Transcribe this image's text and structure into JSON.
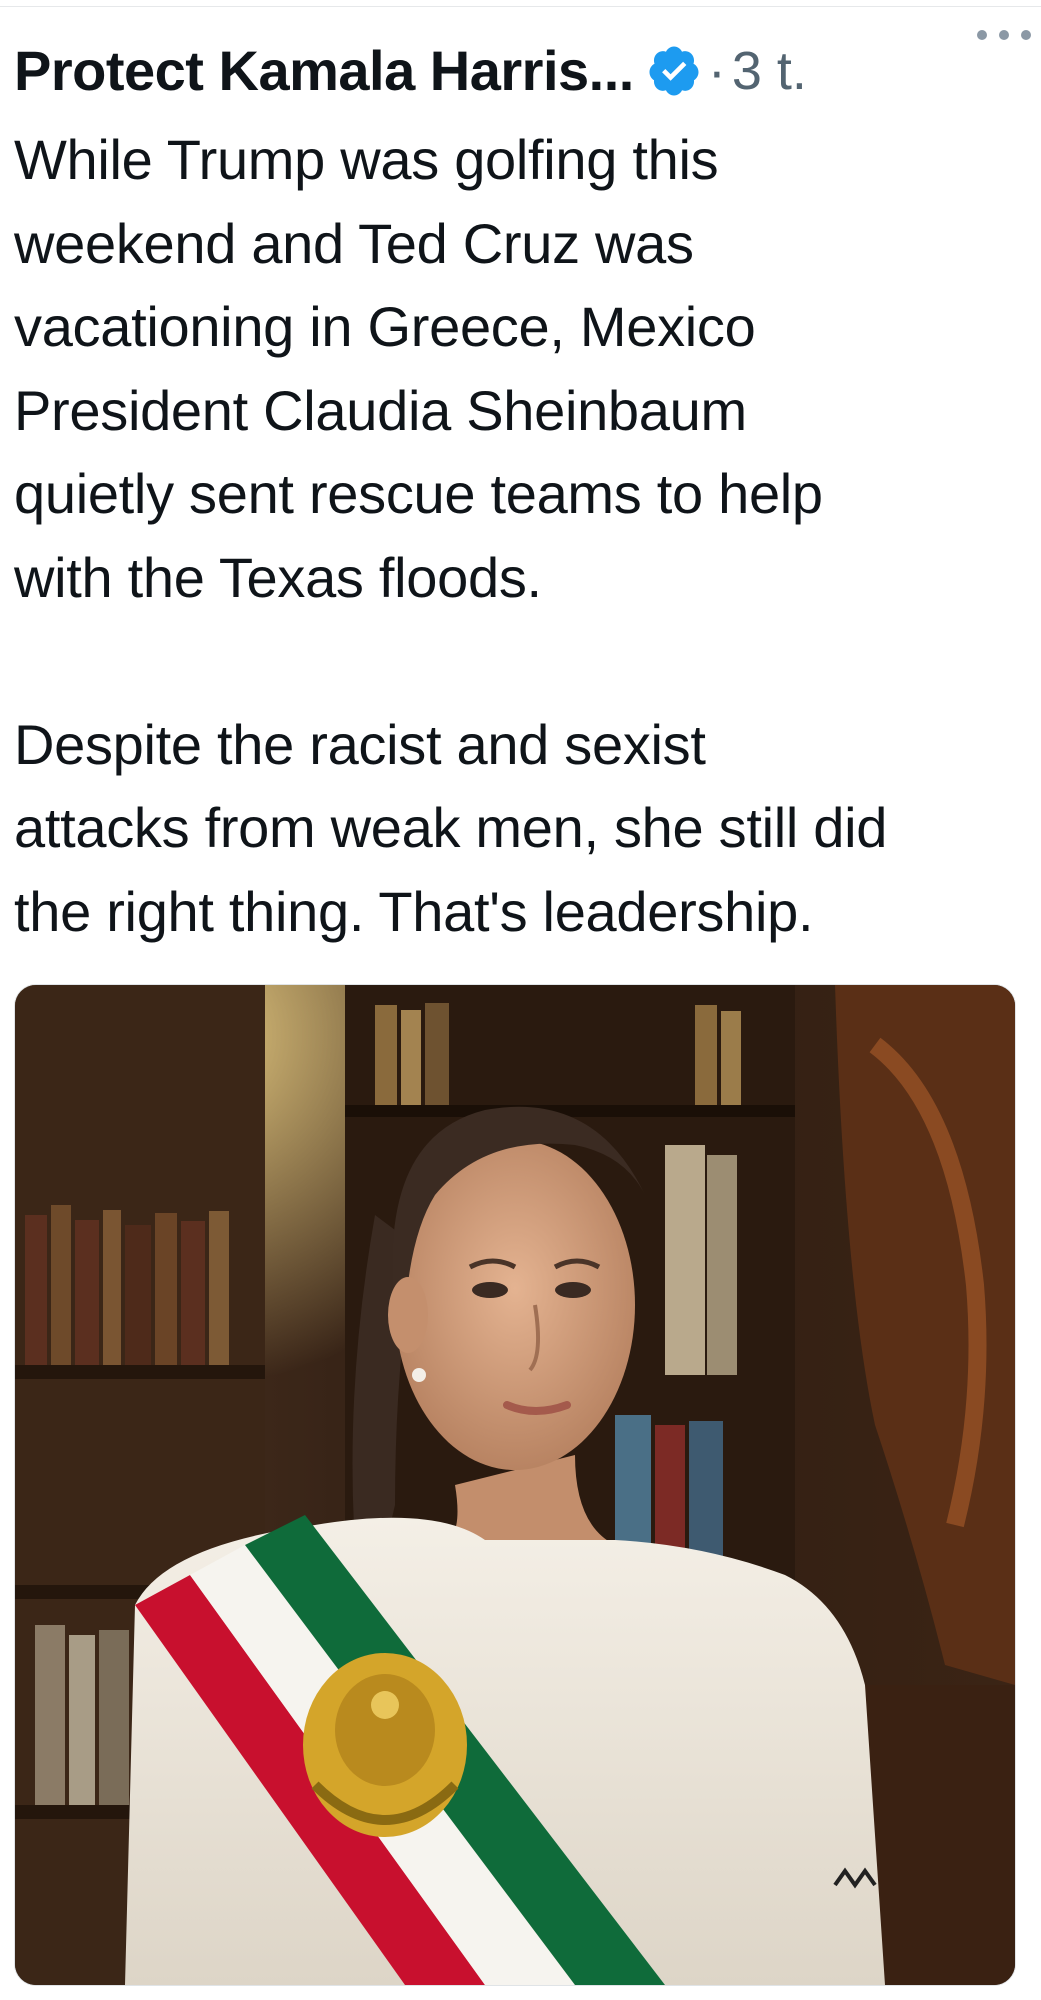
{
  "tweet": {
    "display_name": "Protect Kamala Harris...",
    "separator": "·",
    "time": "3 t.",
    "text_paragraphs": [
      "While Trump was golfing this\nweekend and Ted Cruz was\nvacationing in Greece, Mexico\nPresident Claudia Sheinbaum\nquietly sent rescue teams to help\nwith the Texas floods.",
      "Despite the racist and sexist\nattacks from weak men, she still did\nthe right thing. That's leadership."
    ]
  },
  "icons": {
    "verified": "verified-badge-icon",
    "more": "more-options-icon"
  },
  "colors": {
    "verified_blue": "#1d9bf0",
    "text_primary": "#0f1419",
    "text_secondary": "#536471",
    "sash_green": "#0f6b3a",
    "sash_white": "#f6f4ef",
    "sash_red": "#c8102e",
    "emblem_gold": "#d4a52a"
  }
}
